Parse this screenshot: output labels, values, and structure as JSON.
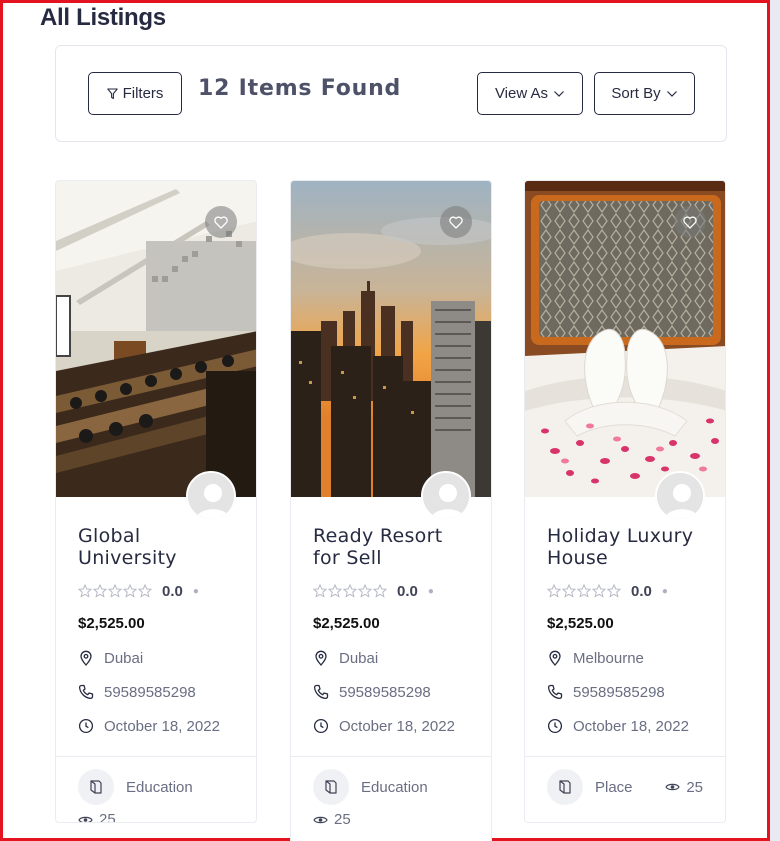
{
  "page": {
    "title": "All Listings"
  },
  "toolbar": {
    "filters_label": "Filters",
    "items_found": "12 Items Found",
    "view_as_label": "View As",
    "sort_by_label": "Sort By"
  },
  "listings": [
    {
      "title": "Global University",
      "rating": "0.0",
      "price": "$2,525.00",
      "location": "Dubai",
      "phone": "59589585298",
      "date": "October 18, 2022",
      "category": "Education",
      "views": "25",
      "image": "lecture-hall-icon"
    },
    {
      "title": "Ready Resort for Sell",
      "rating": "0.0",
      "price": "$2,525.00",
      "location": "Dubai",
      "phone": "59589585298",
      "date": "October 18, 2022",
      "category": "Education",
      "views": "25",
      "image": "city-skyline-icon"
    },
    {
      "title": "Holiday Luxury House",
      "rating": "0.0",
      "price": "$2,525.00",
      "location": "Melbourne",
      "phone": "59589585298",
      "date": "October 18, 2022",
      "category": "Place",
      "views": "25",
      "image": "towel-swans-icon"
    }
  ],
  "colors": {
    "border_accent": "#e3131f",
    "text_dark": "#272b41",
    "text_muted": "#6a6e82"
  }
}
